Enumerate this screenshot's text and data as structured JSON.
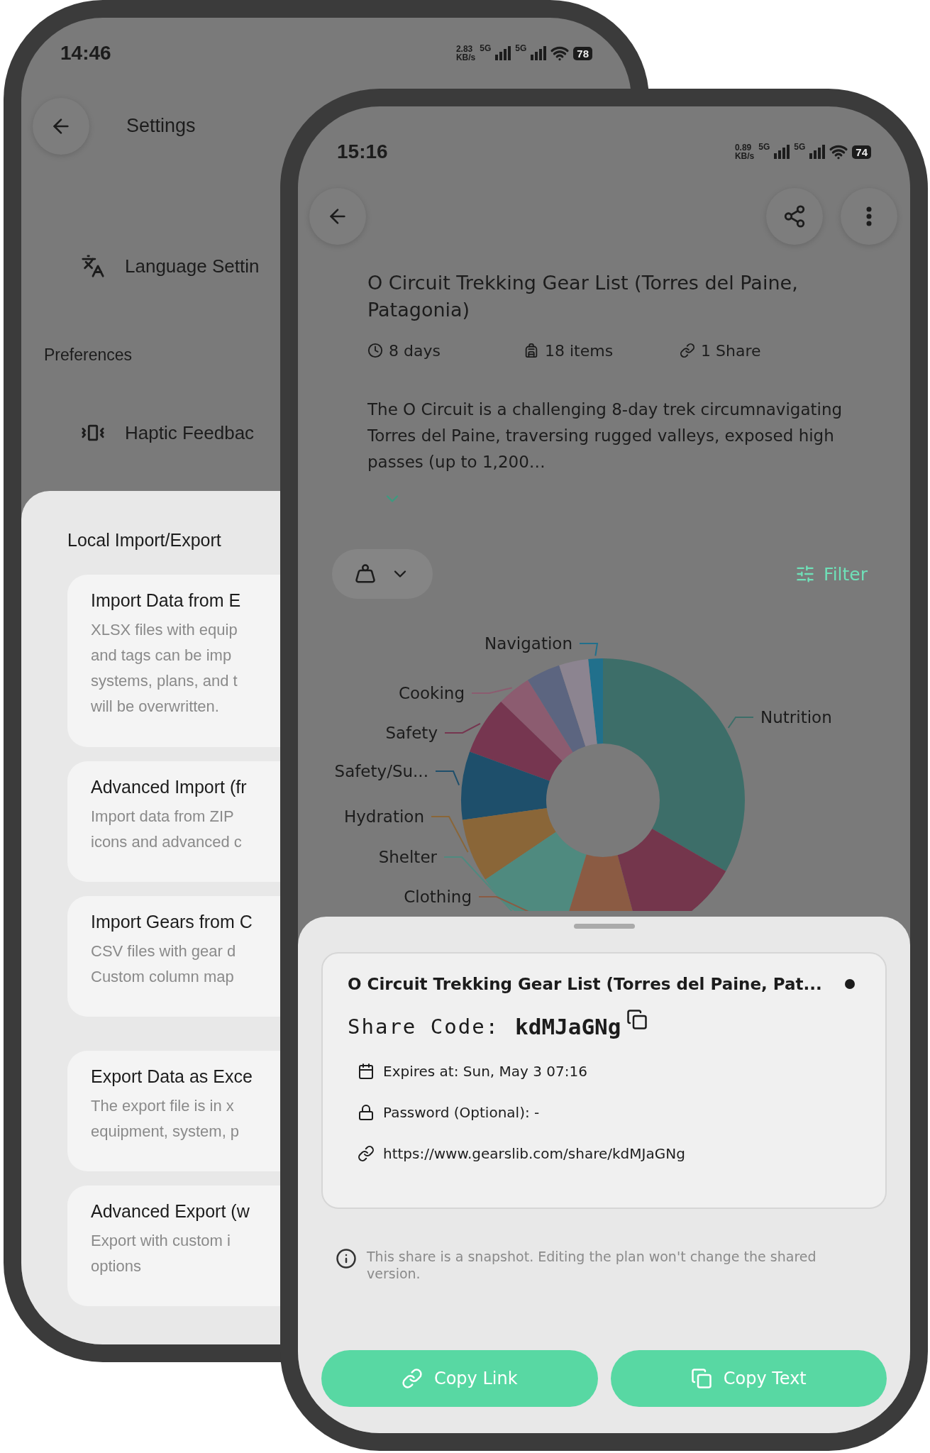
{
  "back_phone": {
    "status_bar": {
      "time": "14:46",
      "speed": "2.83",
      "speed_unit": "KB/s",
      "network_1": "5G",
      "network_2": "5G",
      "battery": "78"
    },
    "header": {
      "title": "Settings"
    },
    "rows": [
      {
        "kind": "setting",
        "label": "Language Settin"
      },
      {
        "kind": "section",
        "label": "Preferences"
      },
      {
        "kind": "setting",
        "label": "Haptic Feedbac"
      }
    ],
    "sheet": {
      "title": "Local Import/Export",
      "cards": [
        {
          "title": "Import Data from E",
          "lines": [
            "XLSX files with equip",
            "and tags can be imp",
            "systems, plans, and t",
            "will be overwritten."
          ]
        },
        {
          "title": "Advanced Import (fr",
          "lines": [
            "Import data from ZIP",
            "icons and advanced c"
          ]
        },
        {
          "title": "Import Gears from C",
          "lines": [
            "CSV files with gear d",
            "Custom column map"
          ]
        },
        {
          "title": "Export Data as Exce",
          "lines": [
            "The export file is in x",
            "equipment, system, p"
          ]
        },
        {
          "title": "Advanced Export (w",
          "lines": [
            "Export with custom i",
            "options"
          ]
        }
      ]
    }
  },
  "front_phone": {
    "status_bar": {
      "time": "15:16",
      "speed": "0.89",
      "speed_unit": "KB/s",
      "network_1": "5G",
      "network_2": "5G",
      "battery": "74"
    },
    "plan": {
      "title": "O Circuit Trekking Gear List (Torres del Paine, Patagonia)",
      "meta": [
        "8 days",
        "18 items",
        "1 Share"
      ],
      "description": "The O Circuit is a challenging 8-day trek circumnavigating Torres del Paine, traversing rugged valleys, exposed high passes (up to 1,200…"
    },
    "toolbar": {
      "filter": "Filter"
    },
    "donut": {
      "segments": [
        {
          "label": "Navigation",
          "color": "#21708c"
        },
        {
          "label": "Cooking",
          "color": "#8c5c70"
        },
        {
          "label": "Nutrition",
          "color": "#3d6e69"
        },
        {
          "label": "Safety",
          "color": "#763650"
        },
        {
          "label": "Safety/Su...",
          "color": "#1e4f6b"
        },
        {
          "label": "Hydration",
          "color": "#8a6638"
        },
        {
          "label": "Shelter",
          "color": "#4f8a7f"
        },
        {
          "label": "Clothing",
          "color": "#8b5b43"
        },
        {
          "color": "#74364c"
        },
        {
          "color": "#5c6580"
        },
        {
          "color": "#8c8490"
        }
      ]
    },
    "share_sheet": {
      "plan_title": "O Circuit Trekking Gear List (Torres del Paine, Pat...",
      "code_label": "Share Code:",
      "code": "kdMJaGNg",
      "details": [
        "Expires at: Sun, May 3 07:16",
        "Password (Optional): -",
        "https://www.gearslib.com/share/kdMJaGNg"
      ],
      "note": "This share is a snapshot. Editing the plan won't change the shared version.",
      "buttons": [
        "Copy Link",
        "Copy Text"
      ]
    }
  }
}
